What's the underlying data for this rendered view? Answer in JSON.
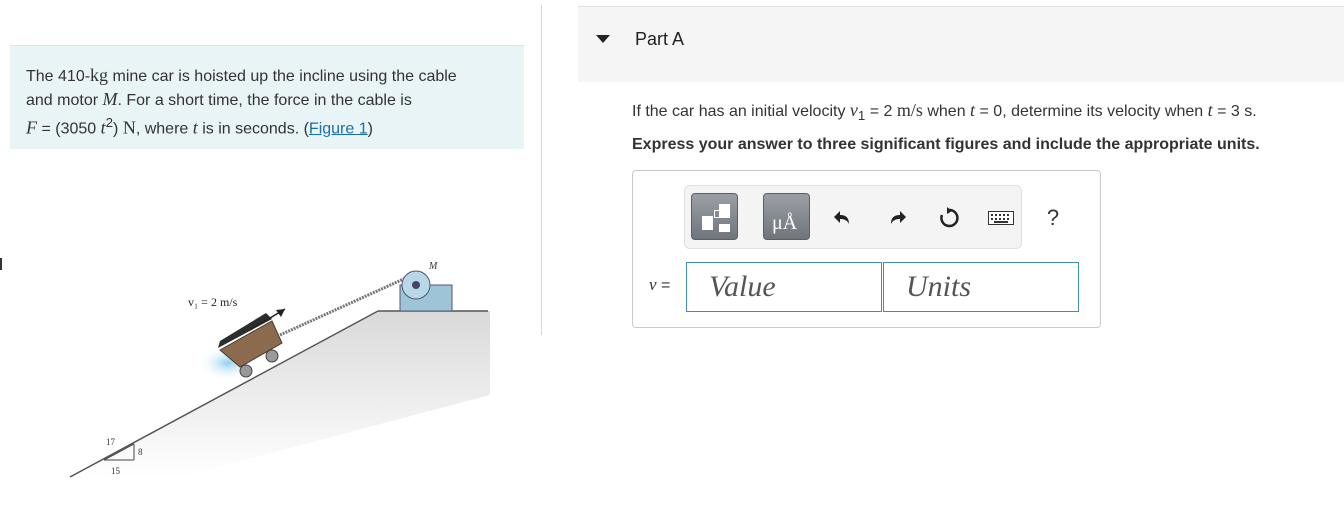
{
  "problem": {
    "mass": "410-",
    "mass_unit": "kg",
    "text1": " mine car is hoisted up the incline using the cable",
    "text2": "and motor ",
    "motor": "M",
    "text3": ". For a short time, the force in the cable is",
    "force_var": "F",
    "force_eq": " = (3050 ",
    "t_var": "t",
    "exponent": "2",
    "force_close": ") ",
    "force_unit": "N",
    "text4": ", where ",
    "text5": " is in seconds. (",
    "figure_link": "Figure 1",
    "text6": ")"
  },
  "figure": {
    "velocity_label": "v₁ = 2 m/s",
    "motor_label": "M",
    "slope_rise": "8",
    "slope_hyp": "17",
    "slope_run": "15"
  },
  "part": {
    "title": "Part A"
  },
  "question": {
    "prefix": "If the car has an initial velocity ",
    "v1": "v",
    "v1_sub": "1",
    "eq1": " = 2 ",
    "unit1": "m/s",
    "when1": " when ",
    "t": "t",
    "eq2": " = 0, determine its velocity when ",
    "eq3": " = 3 s."
  },
  "instruction": "Express your answer to three significant figures and include the appropriate units.",
  "answer": {
    "variable": "v",
    "equals": " =",
    "value_placeholder": "Value",
    "units_placeholder": "Units",
    "units_button_label": "μÅ",
    "help_label": "?"
  },
  "icons": {
    "templates": "templates-icon",
    "units": "units-icon",
    "undo": "undo-icon",
    "redo": "redo-icon",
    "reset": "reset-icon",
    "keyboard": "keyboard-icon",
    "help": "help-icon"
  },
  "colors": {
    "problem_bg": "#e9f4f6",
    "link": "#1a6fa5",
    "field_border": "#3f8fb3",
    "header_bg": "#f5f5f5"
  }
}
